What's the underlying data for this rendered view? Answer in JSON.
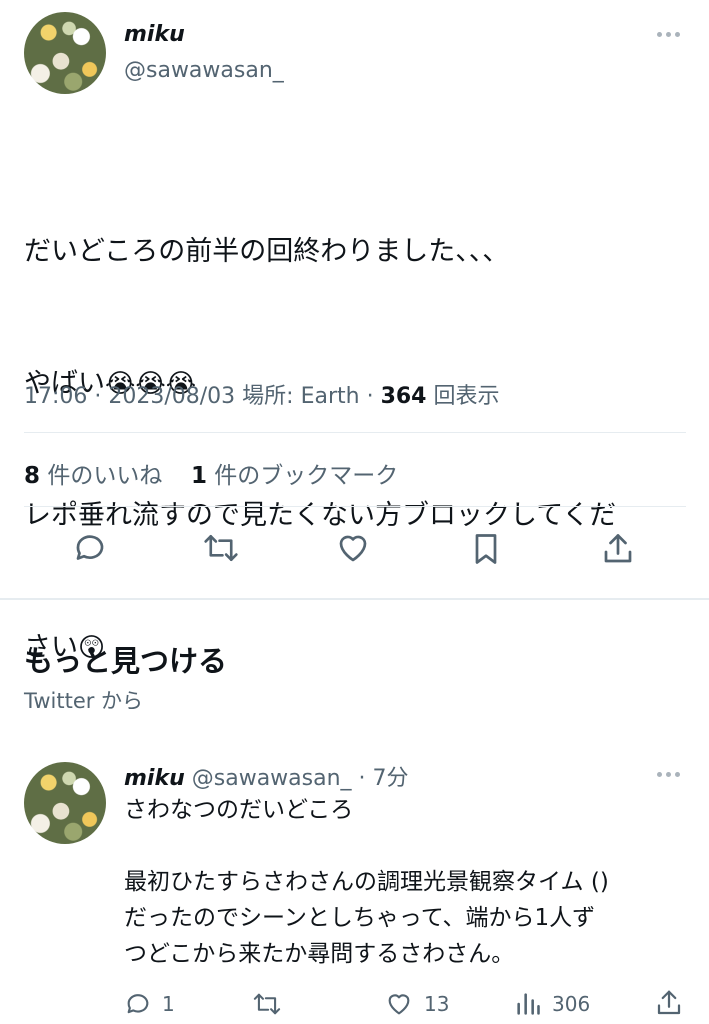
{
  "tweet": {
    "name": "miku",
    "handle": "@sawawasan_",
    "text_line1": "だいどころの前半の回終わりました、、、",
    "text_line2": "やばい",
    "text_line2_emoji": "😭😭😭",
    "text_line3": "レポ垂れ流すので見たくない方ブロックしてくだ",
    "text_line4": "さい",
    "text_line4_emoji": "😲",
    "meta_time": "17:06 · 2023/08/03 場所: Earth · ",
    "meta_views": "364",
    "meta_views_label": " 回表示",
    "likes_count": "8",
    "likes_label": " 件のいいね",
    "bookmarks_count": "1",
    "bookmarks_label": " 件のブックマーク"
  },
  "discover": {
    "title": "もっと見つける",
    "subtitle": "Twitter から"
  },
  "reply": {
    "name": "miku",
    "handle_time": "@sawawasan_ · 7分",
    "text": "さわなつのだいどころ\n\n最初ひたすらさわさんの調理光景観察タイム ()\nだったのでシーンとしちゃって、端から1人ず\nつどこから来たか尋問するさわさん。",
    "replies": "1",
    "likes": "13",
    "views": "306"
  },
  "icons": {
    "reply": "reply-icon",
    "retweet": "retweet-icon",
    "like": "heart-icon",
    "bookmark": "bookmark-icon",
    "share": "share-icon",
    "views": "views-icon",
    "more": "more-icon"
  },
  "colors": {
    "text": "#0f1419",
    "secondary": "#536471",
    "divider": "#e6ecf0"
  }
}
